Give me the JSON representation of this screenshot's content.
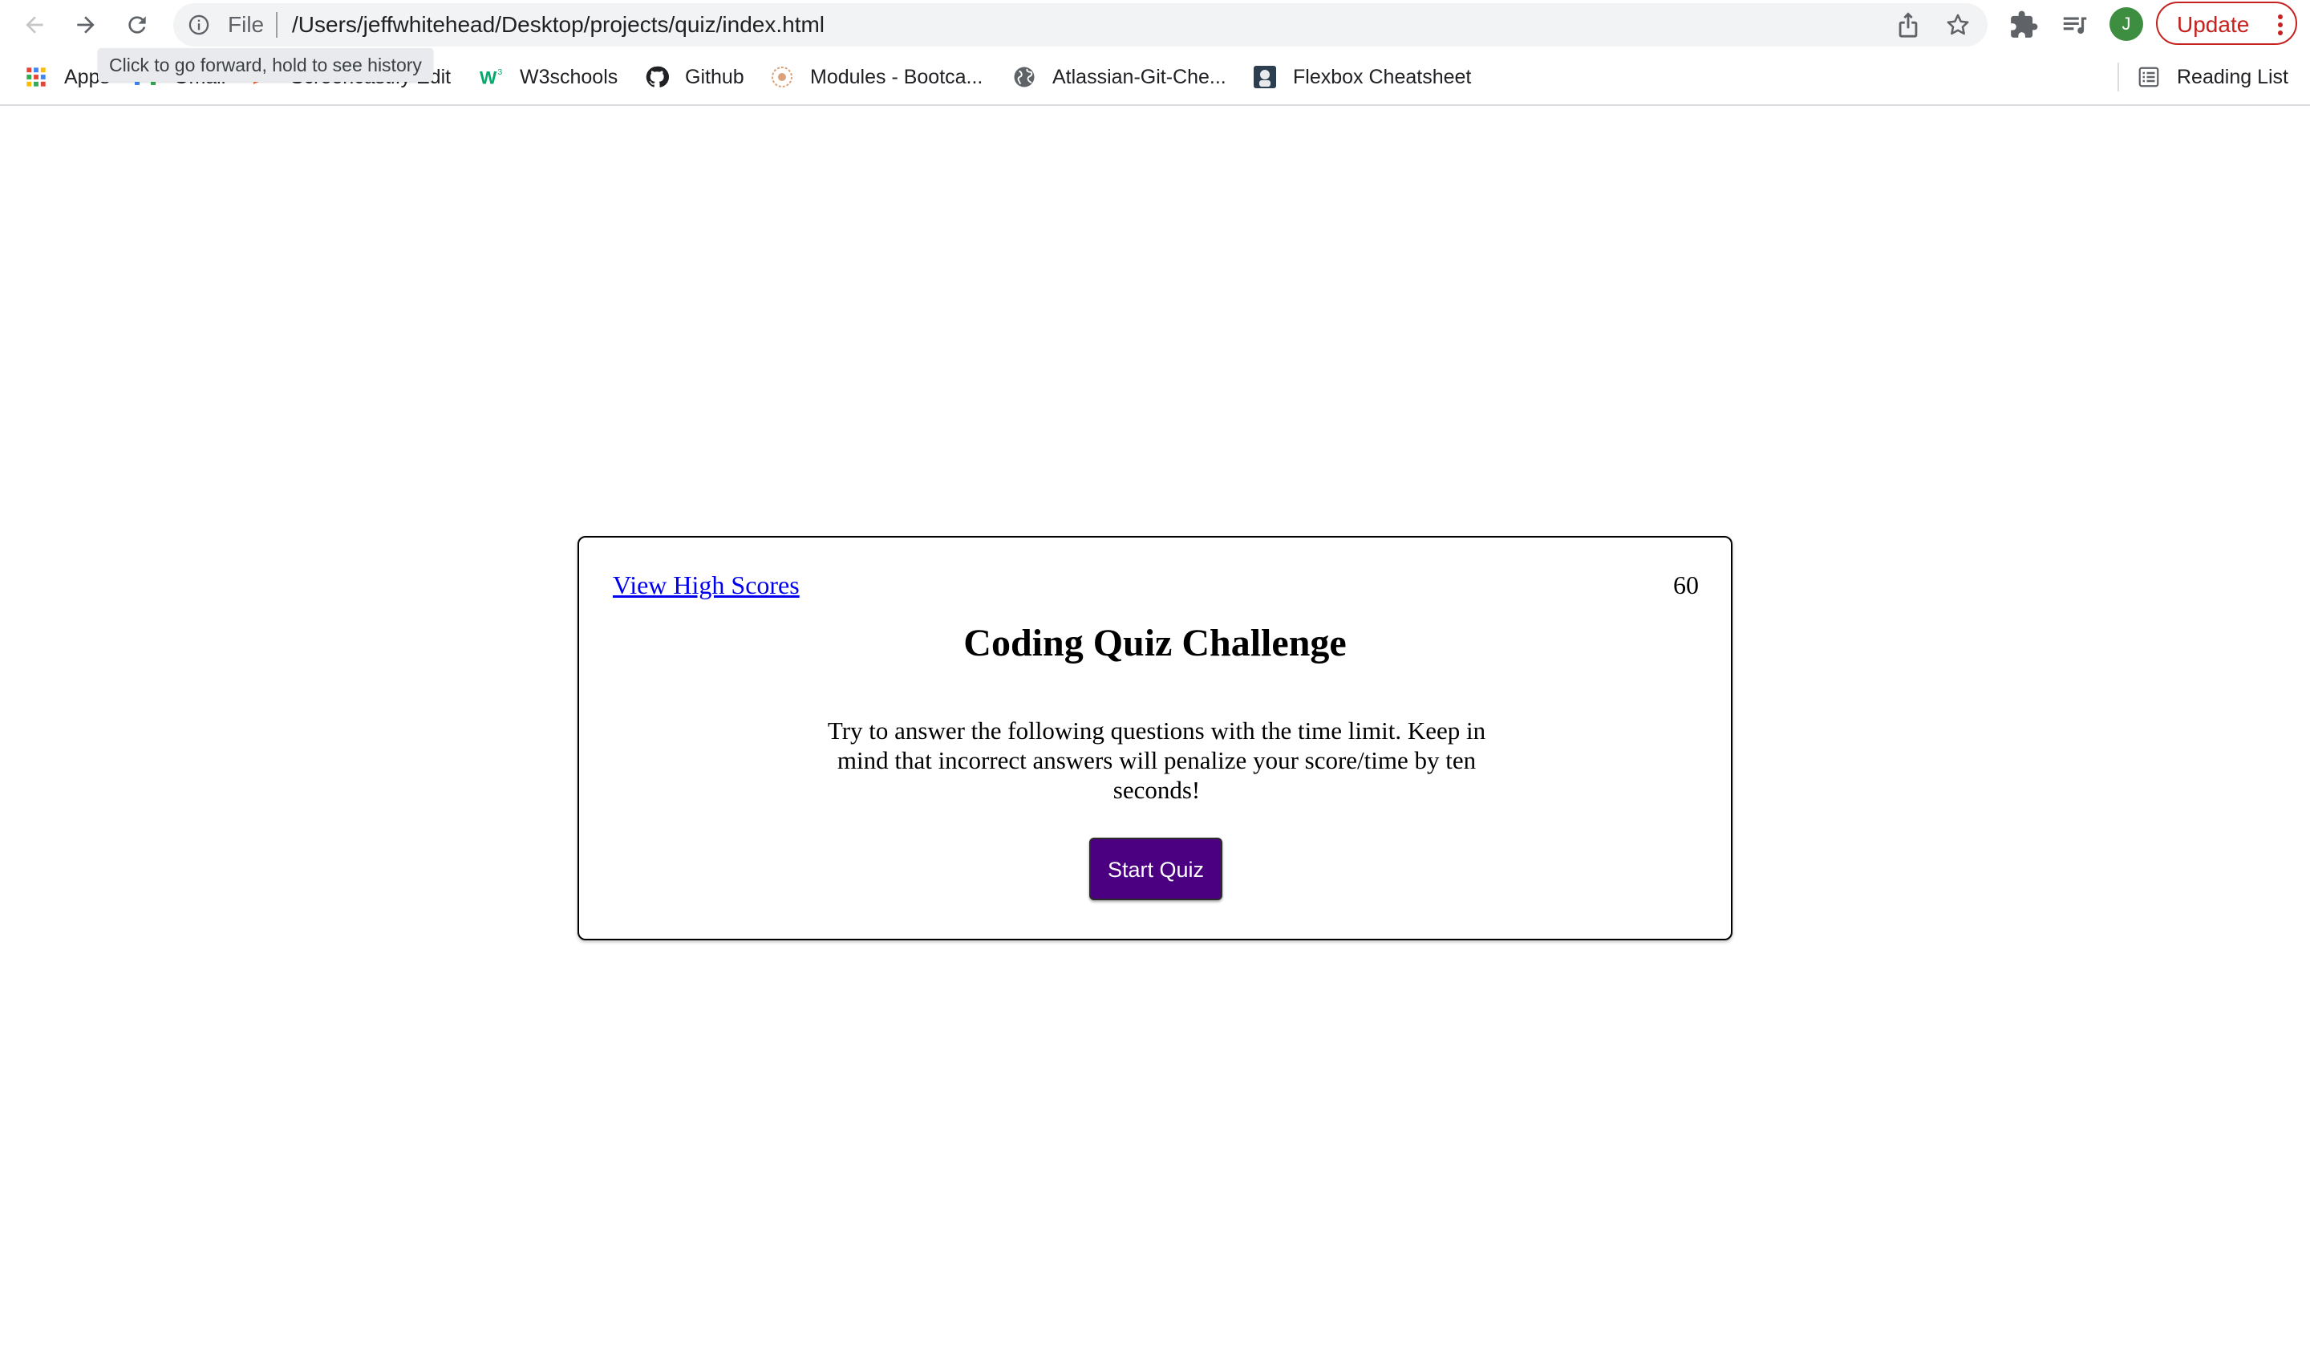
{
  "browser": {
    "url_scheme": "File",
    "url": "/Users/jeffwhitehead/Desktop/projects/quiz/index.html",
    "tooltip": "Click to go forward, hold to see history",
    "profile_initial": "J",
    "update_label": "Update",
    "bookmarks": [
      {
        "label": "Apps",
        "icon": "apps-grid-icon"
      },
      {
        "label": "Gmail",
        "icon": "gmail-icon"
      },
      {
        "label": "Screencastify Edit",
        "icon": "screencastify-icon"
      },
      {
        "label": "W3schools",
        "icon": "w3schools-icon"
      },
      {
        "label": "Github",
        "icon": "github-icon"
      },
      {
        "label": "Modules - Bootca...",
        "icon": "bootcamp-icon"
      },
      {
        "label": "Atlassian-Git-Che...",
        "icon": "globe-icon"
      },
      {
        "label": "Flexbox Cheatsheet",
        "icon": "flexbox-icon"
      }
    ],
    "reading_list_label": "Reading List"
  },
  "page": {
    "high_scores_link": "View High Scores",
    "timer": "60",
    "title": "Coding Quiz Challenge",
    "description": "Try to answer the following questions with the time limit. Keep in mind that incorrect answers will penalize your score/time by ten seconds!",
    "start_button": "Start Quiz"
  },
  "colors": {
    "start_button_bg": "#4b0082",
    "link": "#0000ee",
    "update_accent": "#c5221f",
    "avatar": "#3e8e41"
  }
}
